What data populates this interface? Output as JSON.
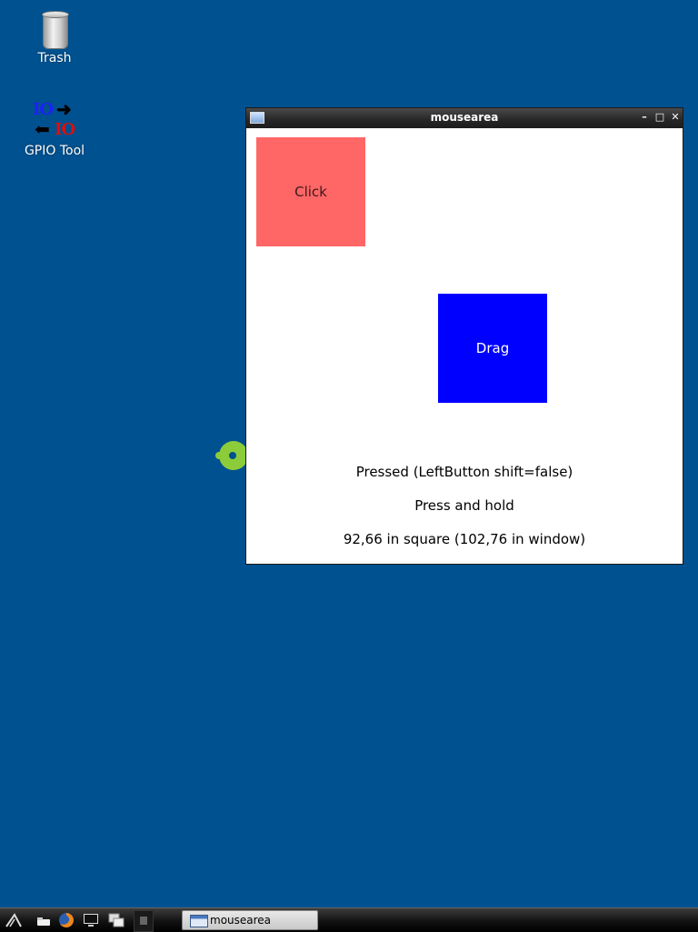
{
  "desktop": {
    "icons": [
      {
        "label": "Trash",
        "icon": "trash-icon"
      },
      {
        "label": "GPIO Tool",
        "icon": "gpio-tool-icon",
        "art_top": "IO",
        "art_bottom": "IO"
      }
    ],
    "background_color": "#00518f"
  },
  "window": {
    "title": "mousearea",
    "buttons": {
      "minimize": "–",
      "maximize": "□",
      "close": "✕"
    },
    "click_box": {
      "label": "Click",
      "color": "#ff6666"
    },
    "drag_box": {
      "label": "Drag",
      "color": "#0000ff"
    },
    "status": {
      "pressed": "Pressed (LeftButton shift=false)",
      "hold": "Press and hold",
      "position": "92,66 in square (102,76 in window)"
    }
  },
  "taskbar": {
    "launchers": [
      "menu-icon",
      "file-manager-icon",
      "browser-icon",
      "terminal-icon",
      "windows-icon"
    ],
    "task": {
      "label": "mousearea"
    }
  }
}
